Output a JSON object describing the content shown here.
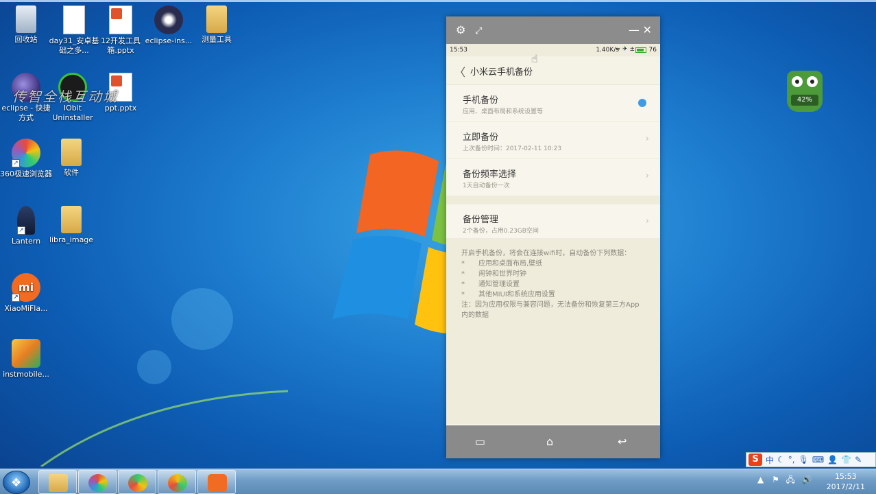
{
  "desktop": {
    "icons": [
      {
        "label": "回收站"
      },
      {
        "label": "day31_安卓基础之多..."
      },
      {
        "label": "12开发工具箱.pptx"
      },
      {
        "label": "eclipse-ins..."
      },
      {
        "label": "测量工具"
      },
      {
        "label": "eclipse - 快捷方式"
      },
      {
        "label": "IObit Uninstaller"
      },
      {
        "label": "ppt.pptx"
      },
      {
        "label": "360极速浏览器"
      },
      {
        "label": "软件"
      },
      {
        "label": "Lantern"
      },
      {
        "label": "libra_image"
      },
      {
        "label": "XiaoMiFla..."
      },
      {
        "label": "instmobile..."
      }
    ],
    "watermark": "传智全栈互动城"
  },
  "phone_window": {
    "titlebar": {
      "settings_icon": "gear-icon",
      "fullscreen_icon": "expand-icon",
      "minimize": "—",
      "close": "✕"
    },
    "statusbar": {
      "time": "15:53",
      "speed": "1.40K/s",
      "signals": "≈ ✈ ±",
      "battery": "76"
    },
    "header": {
      "back": "〈",
      "title": "小米云手机备份"
    },
    "rows": [
      {
        "title": "手机备份",
        "subtitle": "应用、桌面布局和系统设置等",
        "toggle_on": true
      },
      {
        "title": "立即备份",
        "subtitle": "上次备份时间：2017-02-11 10:23"
      },
      {
        "title": "备份频率选择",
        "subtitle": "1天自动备份一次"
      },
      {
        "title": "备份管理",
        "subtitle": "2个备份，占用0.23GB空间"
      }
    ],
    "notes": {
      "intro": "开启手机备份，将会在连接wifi时，自动备份下列数据：",
      "bullets": [
        "应用和桌面布局,壁纸",
        "闹钟和世界时钟",
        "通知管理设置",
        "其他MIUI和系统应用设置"
      ],
      "footer": "注：因为应用权限与兼容问题，无法备份和恢复第三方App内的数据"
    }
  },
  "widget": {
    "percent": "42%"
  },
  "ime": {
    "logo": "S",
    "mode": "中"
  },
  "taskbar": {
    "clock_time": "15:53",
    "clock_date": "2017/2/11"
  },
  "colors": {
    "accent": "#3e9be8",
    "titlebar": "#8c8c8c",
    "phone_bg": "#f5f2e6"
  }
}
